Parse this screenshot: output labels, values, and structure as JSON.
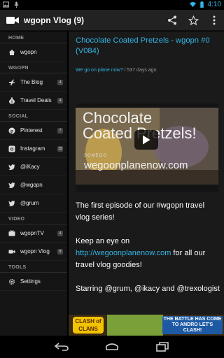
{
  "status_bar": {
    "time": "4:10",
    "left_icons": [
      "picture-icon",
      "microphone-icon"
    ],
    "right_icons": [
      "wifi-icon",
      "battery-icon"
    ]
  },
  "action_bar": {
    "app_icon": "video-camera-icon",
    "title": "wgopn Vlog (9)",
    "actions": [
      "share-icon",
      "star-icon",
      "overflow-menu-icon"
    ]
  },
  "sidebar": {
    "sections": [
      {
        "label": "HOME",
        "items": [
          {
            "label": "wgopn",
            "icon": "home-icon",
            "badge": ""
          }
        ]
      },
      {
        "label": "WGOPN",
        "items": [
          {
            "label": "The Blog",
            "icon": "airplane-icon",
            "badge": "4"
          },
          {
            "label": "Travel Deals",
            "icon": "money-bag-icon",
            "badge": "4"
          }
        ]
      },
      {
        "label": "SOCIAL",
        "items": [
          {
            "label": "Pinterest",
            "icon": "pinterest-icon",
            "badge": "7"
          },
          {
            "label": "Instagram",
            "icon": "instagram-icon",
            "badge": "19"
          },
          {
            "label": "@iKacy",
            "icon": "twitter-icon",
            "badge": ""
          },
          {
            "label": "@wgopn",
            "icon": "twitter-icon",
            "badge": ""
          },
          {
            "label": "@grum",
            "icon": "twitter-icon",
            "badge": ""
          }
        ]
      },
      {
        "label": "VIDEO",
        "items": [
          {
            "label": "wgopnTV",
            "icon": "tv-icon",
            "badge": "4"
          },
          {
            "label": "wgopn Vlog",
            "icon": "video-camera-icon",
            "badge": "8"
          }
        ]
      },
      {
        "label": "TOOLS",
        "items": [
          {
            "label": "Settings",
            "icon": "gear-icon",
            "badge": ""
          }
        ]
      }
    ]
  },
  "post": {
    "title": "Chocolate Coated Pretzels - wgopn #0 (V084)",
    "meta_link": "We go on plane now?",
    "meta_sep": " / ",
    "meta_age": "537 days ago",
    "video": {
      "overlay_title": "Chocolate\nCoated Pretzels!",
      "overlay_small": "SOMEOO",
      "overlay_site": "wegoonplanenow.com"
    },
    "para1": "The first episode of our #wgopn travel vlog series!",
    "para2_before": "Keep an eye on ",
    "para2_link": "http://wegoonplanenow.com",
    "para2_after": " for all our travel vlog goodies!",
    "para3": "Starring @grum, @ikacy and @trexologist"
  },
  "ad": {
    "logo_text": "CLASH of CLANS",
    "headline": "THE BATTLE HAS COME TO ANDRO LET'S CLASH!"
  },
  "nav_bar": [
    "back-icon",
    "home-icon",
    "recents-icon"
  ],
  "colors": {
    "accent": "#33b5e5",
    "sidebar_bg": "#151515",
    "content_bg": "#1a1a1a"
  }
}
